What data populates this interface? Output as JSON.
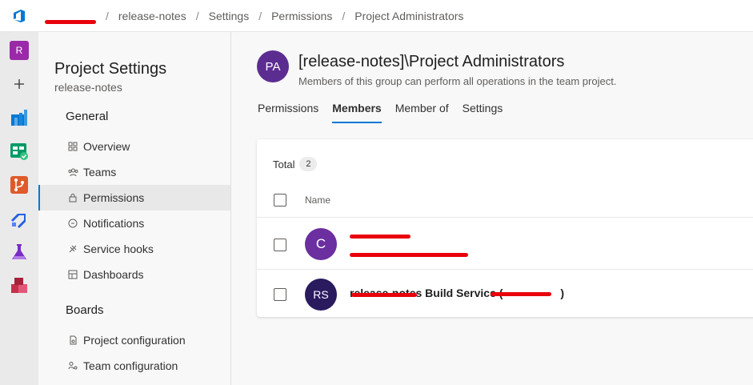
{
  "colors": {
    "accent": "#0078d4",
    "group_avatar": "#5c2d91",
    "member1_avatar": "#6b2fa0",
    "member2_avatar": "#2a1a5e",
    "redaction": "#e8000b"
  },
  "topbar": {
    "logo_icon": "azure-devops-icon",
    "breadcrumbs": [
      "release-notes",
      "Settings",
      "Permissions",
      "Project Administrators"
    ],
    "separator": "/"
  },
  "rail": {
    "avatar_letter": "R",
    "icons": [
      "add-icon",
      "overview-icon",
      "boards-icon",
      "repos-icon",
      "pipelines-icon",
      "test-plans-icon",
      "artifacts-icon"
    ]
  },
  "nav": {
    "title": "Project Settings",
    "subtitle": "release-notes",
    "general_heading": "General",
    "general_items": [
      {
        "label": "Overview",
        "icon": "overview-icon"
      },
      {
        "label": "Teams",
        "icon": "teams-icon"
      },
      {
        "label": "Permissions",
        "icon": "lock-icon",
        "active": true
      },
      {
        "label": "Notifications",
        "icon": "notification-icon"
      },
      {
        "label": "Service hooks",
        "icon": "service-hooks-icon"
      },
      {
        "label": "Dashboards",
        "icon": "dashboard-icon"
      }
    ],
    "boards_heading": "Boards",
    "boards_items": [
      {
        "label": "Project configuration",
        "icon": "project-config-icon"
      },
      {
        "label": "Team configuration",
        "icon": "team-config-icon"
      }
    ]
  },
  "group": {
    "avatar_initials": "PA",
    "title": "[release-notes]\\Project Administrators",
    "description": "Members of this group can perform all operations in the team project."
  },
  "tabs": [
    {
      "label": "Permissions",
      "active": false
    },
    {
      "label": "Members",
      "active": true
    },
    {
      "label": "Member of",
      "active": false
    },
    {
      "label": "Settings",
      "active": false
    }
  ],
  "members": {
    "total_label": "Total",
    "total_count": "2",
    "column_name": "Name",
    "rows": [
      {
        "initials": "C",
        "name": "",
        "subtitle": ""
      },
      {
        "initials": "RS",
        "name": "release-notes Build Service (",
        "name_end": ")",
        "subtitle": ""
      }
    ]
  }
}
